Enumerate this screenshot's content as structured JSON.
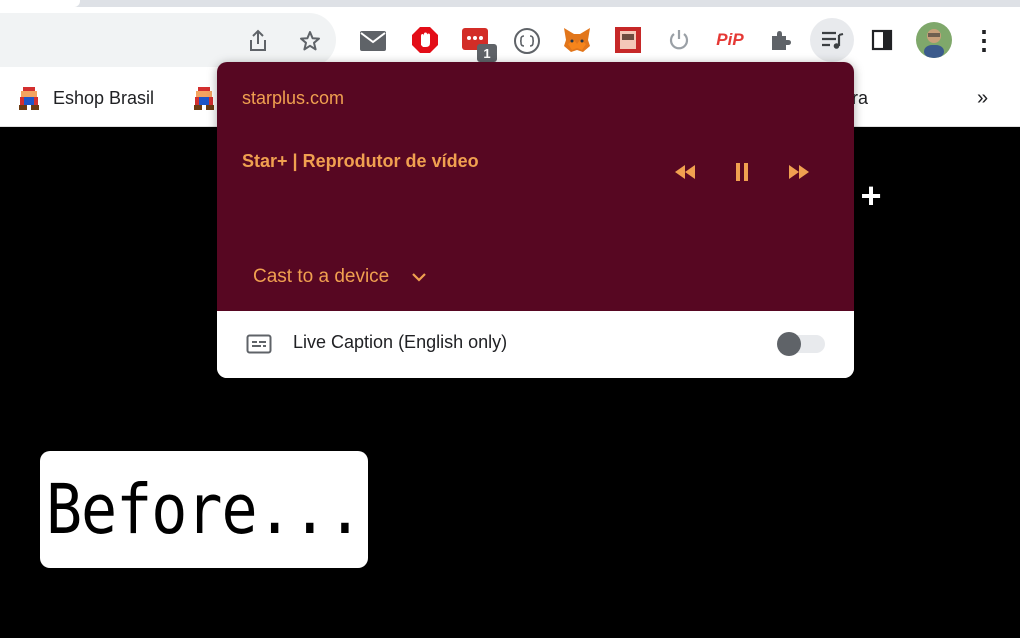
{
  "toolbar": {
    "icons": [
      "share-icon",
      "bookmark-star-icon",
      "gmail-icon",
      "adblock-icon",
      "lastpass-icon",
      "json-viewer-icon",
      "metamask-icon",
      "extension-red-icon",
      "power-icon",
      "pip-icon",
      "extensions-puzzle-icon",
      "media-controls-icon",
      "side-panel-icon",
      "profile-avatar",
      "menu-kebab-icon"
    ],
    "lastpass_badge": "1",
    "pip_label": "PiP",
    "menu_glyph": "⋮"
  },
  "bookmarks": {
    "items": [
      {
        "label": "Eshop Brasil"
      },
      {
        "label": ""
      },
      {
        "label": "ra"
      }
    ],
    "overflow": "»"
  },
  "media_popup": {
    "origin": "starplus.com",
    "title": "Star+ | Reprodutor de vídeo",
    "cast_label": "Cast to a device",
    "live_caption_label": "Live Caption (English only)",
    "live_caption_enabled": false,
    "accent_color": "#f0a050",
    "background_color": "#570722"
  },
  "page": {
    "plus": "+",
    "before_label": "Before..."
  }
}
